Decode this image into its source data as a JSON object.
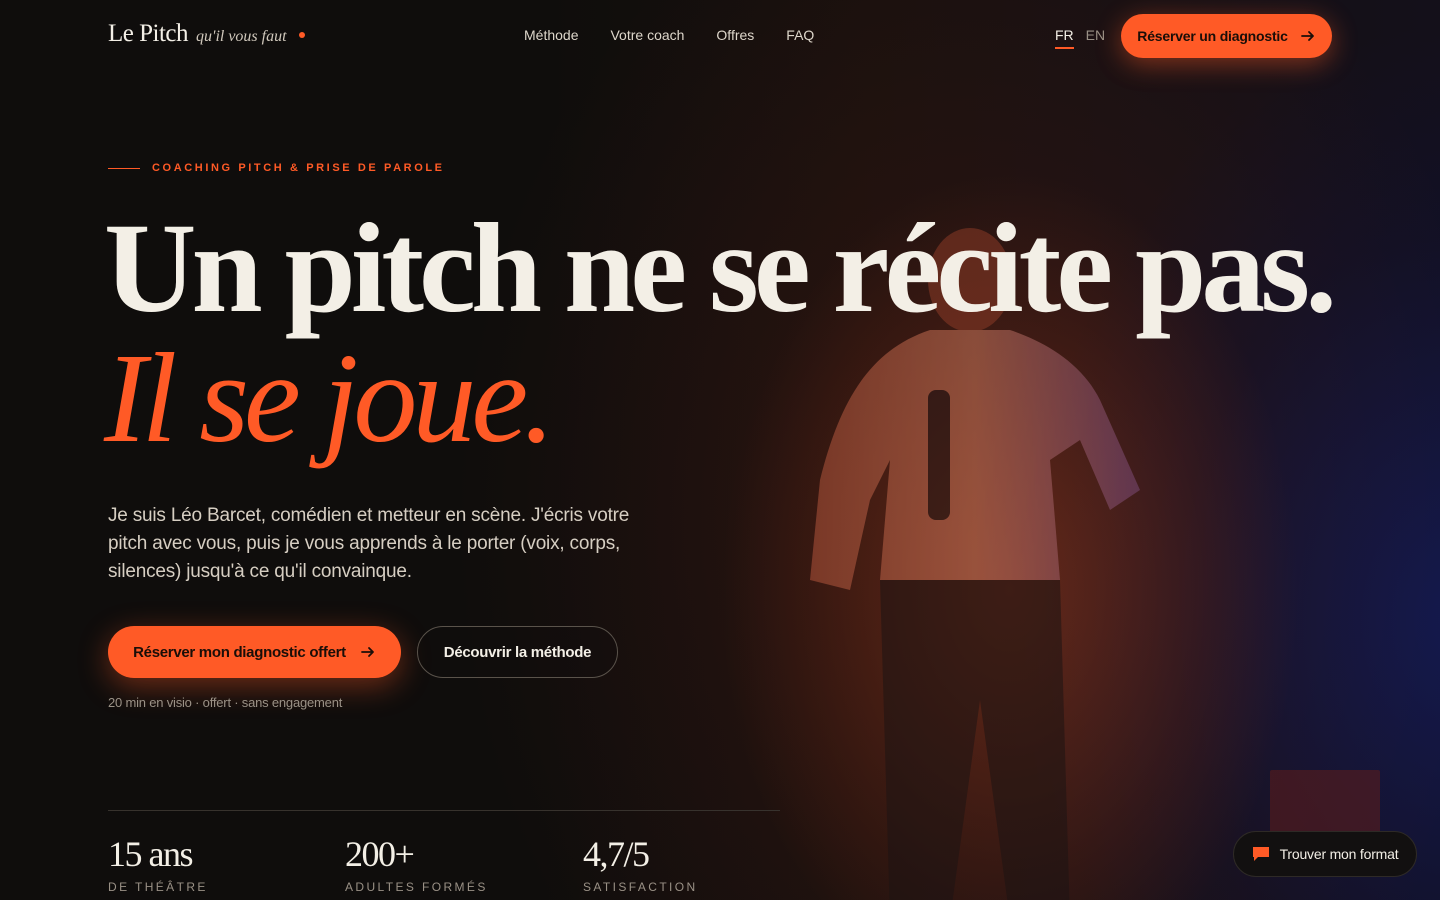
{
  "colors": {
    "accent": "#ff5a26",
    "background": "#0f0d0c",
    "text": "#f3efe6",
    "muted": "#9a9186"
  },
  "header": {
    "logo": {
      "name": "Le Pitch",
      "tagline": "qu'il vous faut"
    },
    "nav": [
      "Méthode",
      "Votre coach",
      "Offres",
      "FAQ"
    ],
    "languages": {
      "active": "FR",
      "other": "EN"
    },
    "cta_label": "Réserver un diagnostic",
    "cta_icon": "arrow-right-icon"
  },
  "hero": {
    "eyebrow": "COACHING PITCH & PRISE DE PAROLE",
    "title_line1": "Un pitch ne se récite pas.",
    "title_line2": "Il se joue.",
    "lede": "Je suis Léo Barcet, comédien et metteur en scène. J'écris votre pitch avec vous, puis je vous apprends à le porter (voix, corps, silences) jusqu'à ce qu'il convainque.",
    "primary_cta": "Réserver mon diagnostic offert",
    "secondary_cta": "Découvrir la méthode",
    "note": "20 min en visio · offert · sans engagement"
  },
  "stats": [
    {
      "value": "15 ans",
      "label": "DE THÉÂTRE"
    },
    {
      "value": "200+",
      "label": "ADULTES FORMÉS"
    },
    {
      "value": "4,7/5",
      "label": "SATISFACTION"
    }
  ],
  "chat": {
    "label": "Trouver mon format",
    "icon": "chat-bubble-icon"
  }
}
